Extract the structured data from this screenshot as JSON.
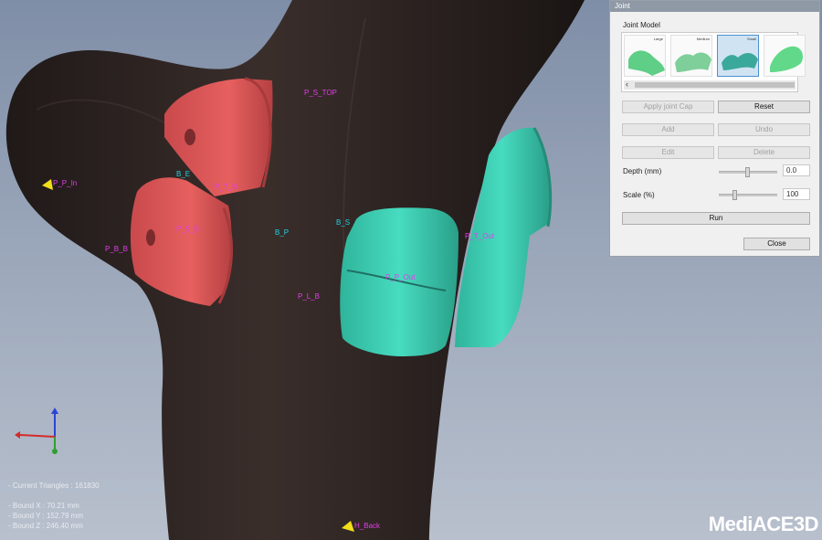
{
  "viewport": {
    "labels": [
      {
        "id": "p-s-top",
        "text": "P_S_TOP",
        "color": "magenta"
      },
      {
        "id": "b-e",
        "text": "B_E",
        "color": "cyan"
      },
      {
        "id": "p-p-in",
        "text": "P_P_In",
        "color": "magenta"
      },
      {
        "id": "p-t-b",
        "text": "P_T_B",
        "color": "magenta"
      },
      {
        "id": "p-b-b",
        "text": "P_B_B",
        "color": "magenta"
      },
      {
        "id": "p-s-b",
        "text": "P_S_B",
        "color": "magenta"
      },
      {
        "id": "b-p",
        "text": "B_P",
        "color": "cyan"
      },
      {
        "id": "b-s",
        "text": "B_S",
        "color": "cyan"
      },
      {
        "id": "p-t-out",
        "text": "P_T_Out",
        "color": "magenta"
      },
      {
        "id": "p-p-out",
        "text": "P_P_Out",
        "color": "magenta"
      },
      {
        "id": "p-l-b",
        "text": "P_L_B",
        "color": "magenta"
      },
      {
        "id": "h-back",
        "text": "H_Back",
        "color": "magenta"
      }
    ],
    "colors": {
      "left_caps": "#e2595a",
      "right_caps": "#3ccdb1",
      "mesh": "#2b2221",
      "marker": "#f1df1a"
    }
  },
  "stats": {
    "current_triangles": "- Current Triangles : 161830",
    "bound_x": "- Bound X : 70.21 mm",
    "bound_y": "- Bound Y : 152.79 mm",
    "bound_z": "- Bound Z : 246.40 mm"
  },
  "logo": {
    "text_a": "Medi",
    "text_b": "ACE3D"
  },
  "dialog": {
    "title": "Joint",
    "section": "Joint Model",
    "models": [
      {
        "label": "Large",
        "selected": false
      },
      {
        "label": "Medium",
        "selected": false
      },
      {
        "label": "Small",
        "selected": true
      },
      {
        "label": "",
        "selected": false
      }
    ],
    "buttons": {
      "apply": "Apply joint Cap",
      "reset": "Reset",
      "add": "Add",
      "undo": "Undo",
      "edit": "Edit",
      "delete": "Delete",
      "run": "Run",
      "close": "Close"
    },
    "depth": {
      "label": "Depth (mm)",
      "value": "0.0"
    },
    "scale": {
      "label": "Scale (%)",
      "value": "100"
    }
  }
}
